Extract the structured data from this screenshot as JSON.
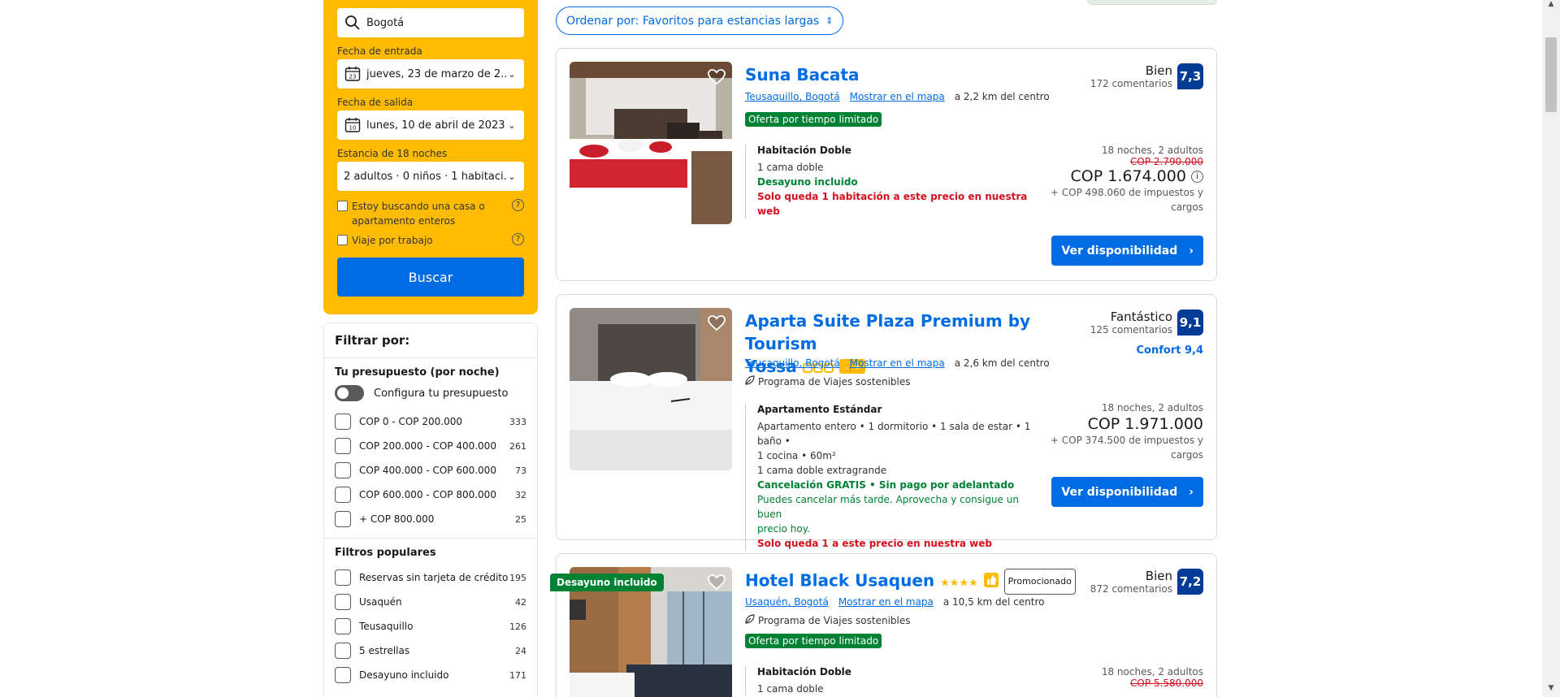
{
  "search": {
    "destination": "Bogotá",
    "checkin_label": "Fecha de entrada",
    "checkin_value": "jueves, 23 de marzo de 2...",
    "checkin_day": "23",
    "checkout_label": "Fecha de salida",
    "checkout_value": "lunes, 10 de abril de 2023",
    "checkout_day": "10",
    "stay_label": "Estancia de 18 noches",
    "guests_value": "2 adultos · 0 niños · 1 habitaci...",
    "whole_place_label": "Estoy buscando una casa o apartamento enteros",
    "work_trip_label": "Viaje por trabajo",
    "help_glyph": "?",
    "search_button": "Buscar"
  },
  "filters": {
    "title": "Filtrar por:",
    "budget": {
      "title": "Tu presupuesto (por noche)",
      "toggle_label": "Configura tu presupuesto",
      "items": [
        {
          "label": "COP 0 - COP 200.000",
          "count": "333"
        },
        {
          "label": "COP 200.000 - COP 400.000",
          "count": "261"
        },
        {
          "label": "COP 400.000 - COP 600.000",
          "count": "73"
        },
        {
          "label": "COP 600.000 - COP 800.000",
          "count": "32"
        },
        {
          "label": "+ COP 800.000",
          "count": "25"
        }
      ]
    },
    "popular": {
      "title": "Filtros populares",
      "items": [
        {
          "label": "Reservas sin tarjeta de crédito",
          "count": "195"
        },
        {
          "label": "Usaquén",
          "count": "42"
        },
        {
          "label": "Teusaquillo",
          "count": "126"
        },
        {
          "label": "5 estrellas",
          "count": "24"
        },
        {
          "label": "Desayuno incluido",
          "count": "171"
        }
      ]
    }
  },
  "sort": {
    "label": "Ordenar por: Favoritos para estancias largas"
  },
  "hotels": [
    {
      "name": "Suna Bacata",
      "area": "Teusaquillo, Bogotá",
      "map": "Mostrar en el mapa",
      "distance": "a 2,2 km del centro",
      "badge": "Oferta por tiempo limitado",
      "room_type": "Habitación Doble",
      "bed": "1 cama doble",
      "breakfast": "Desayuno incluido",
      "scarcity": "Solo queda 1 habitación a este precio en nuestra web",
      "rating_word": "Bien",
      "reviews": "172 comentarios",
      "score": "7,3",
      "nights": "18 noches, 2 adultos",
      "old_price": "COP 2.790.000",
      "price": "COP 1.674.000",
      "tax_line1": "+ COP 498.060 de impuestos y",
      "tax_line2": "cargos",
      "button": "Ver disponibilidad"
    },
    {
      "name_line1": "Aparta Suite Plaza Premium by Tourism",
      "name_line2": "Yossa",
      "area": "Teusaquillo, Bogotá",
      "map": "Mostrar en el mapa",
      "distance": "a 2,6 km del centro",
      "sustainable": "Programa de Viajes sostenibles",
      "room_type": "Apartamento Estándar",
      "desc1": "Apartamento entero • 1 dormitorio • 1 sala de estar • 1 baño •",
      "desc2": "1 cocina • 60m²",
      "bed": "1 cama doble extragrande",
      "cancel": "Cancelación GRATIS • Sin pago por adelantado",
      "cancel_sub1": "Puedes cancelar más tarde. Aprovecha y consigue un buen",
      "cancel_sub2": "precio hoy.",
      "scarcity": "Solo queda 1 a este precio en nuestra web",
      "rating_word": "Fantástico",
      "reviews": "125 comentarios",
      "score": "9,1",
      "comfort": "Confort 9,4",
      "nights": "18 noches, 2 adultos",
      "price": "COP 1.971.000",
      "tax_line1": "+ COP 374.500 de impuestos y",
      "tax_line2": "cargos",
      "button": "Ver disponibilidad"
    },
    {
      "name": "Hotel Black Usaquen",
      "stars": "★★★★",
      "promo": "Promocionado",
      "ribbon": "Desayuno incluido",
      "area": "Usaquén, Bogotá",
      "map": "Mostrar en el mapa",
      "distance": "a 10,5 km del centro",
      "sustainable": "Programa de Viajes sostenibles",
      "badge": "Oferta por tiempo limitado",
      "room_type": "Habitación Doble",
      "bed": "1 cama doble",
      "rating_word": "Bien",
      "reviews": "872 comentarios",
      "score": "7,2",
      "nights": "18 noches, 2 adultos",
      "old_price": "COP 5.580.000"
    }
  ]
}
